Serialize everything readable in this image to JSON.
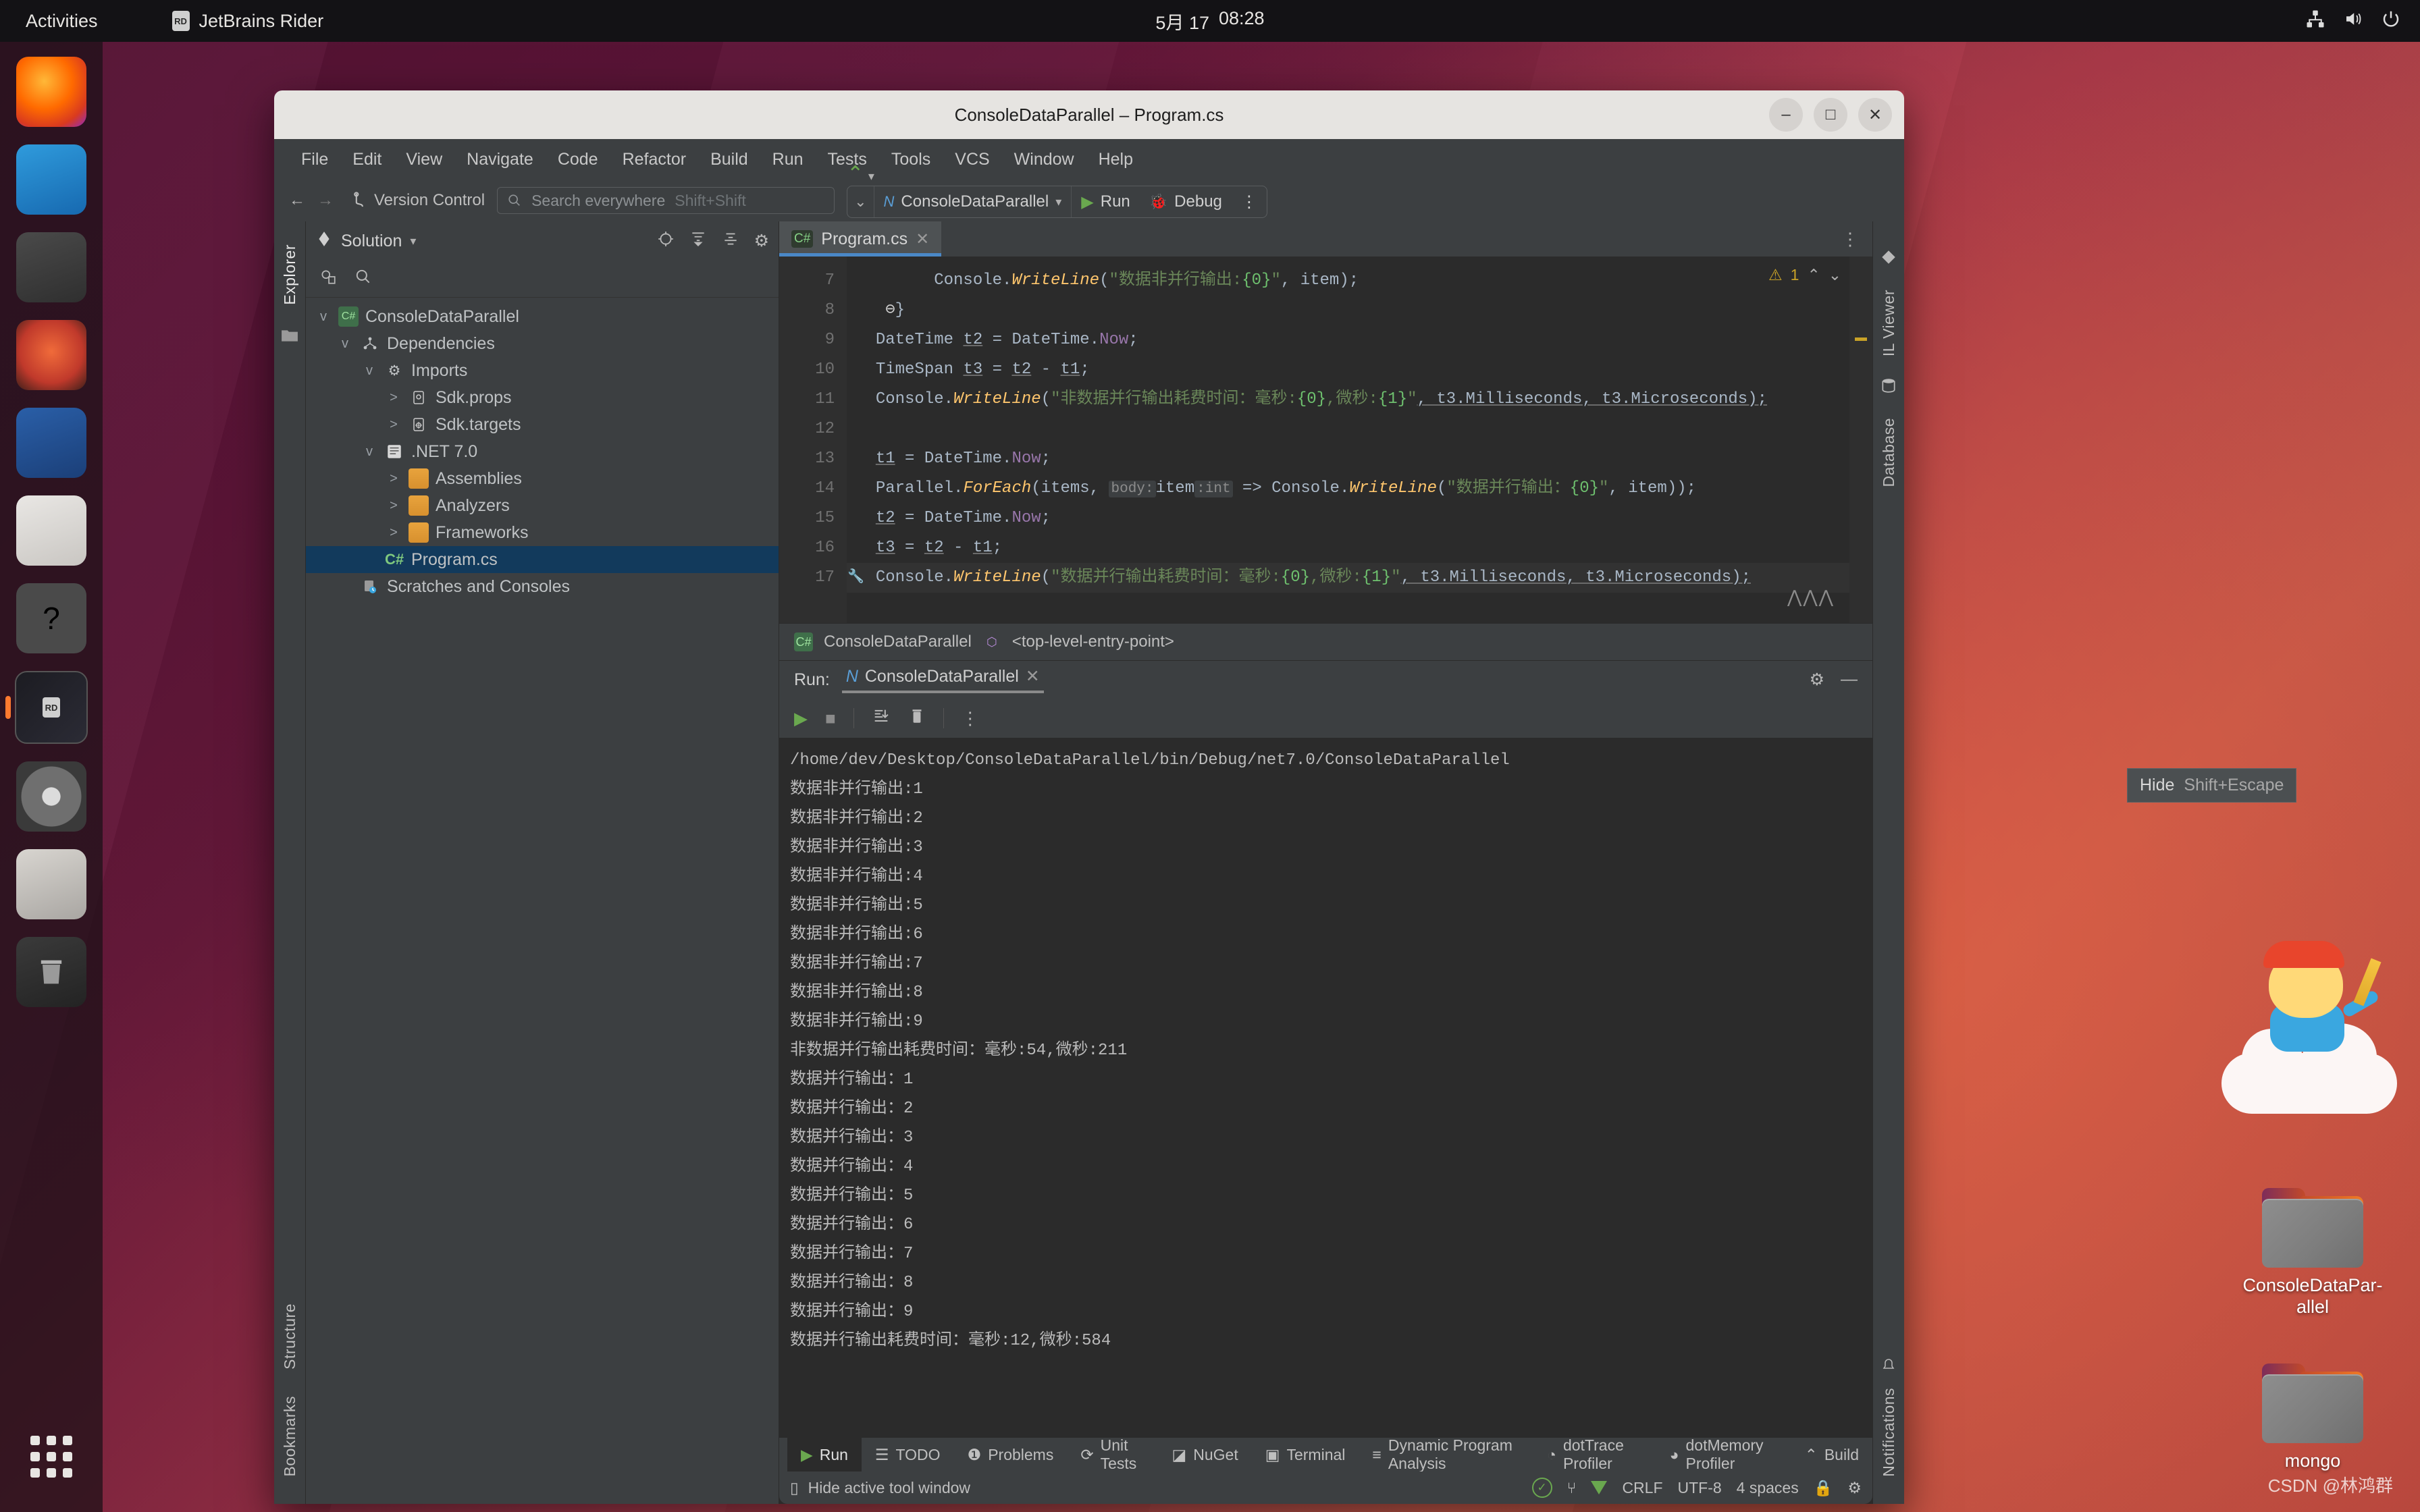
{
  "topbar": {
    "activities": "Activities",
    "app_name": "JetBrains Rider",
    "app_icon": "rider-icon",
    "date": "5月 17",
    "time": "08:28",
    "tray": [
      "network-icon",
      "volume-icon",
      "power-icon"
    ]
  },
  "dock": {
    "items": [
      {
        "name": "firefox",
        "label": "Firefox"
      },
      {
        "name": "thunderbird",
        "label": "Thunderbird"
      },
      {
        "name": "files",
        "label": "Files"
      },
      {
        "name": "rhythmbox",
        "label": "Rhythmbox"
      },
      {
        "name": "libreoffice-writer",
        "label": "LibreOffice Writer"
      },
      {
        "name": "ubuntu-software",
        "label": "Ubuntu Software"
      },
      {
        "name": "help",
        "label": "Help"
      },
      {
        "name": "rider",
        "label": "JetBrains Rider"
      },
      {
        "name": "disc",
        "label": "Disc"
      },
      {
        "name": "text-editor",
        "label": "Text Editor"
      },
      {
        "name": "trash",
        "label": "Trash"
      }
    ],
    "show_apps": "Show Applications"
  },
  "desktop": {
    "icons": [
      {
        "label": "ConsoleDataPar-\nallel"
      },
      {
        "label": "mongo"
      }
    ],
    "watermark": "CSDN @林鸿群"
  },
  "window": {
    "title": "ConsoleDataParallel – Program.cs",
    "controls": {
      "minimize": "–",
      "maximize": "□",
      "close": "✕"
    }
  },
  "menubar": {
    "items": [
      "File",
      "Edit",
      "View",
      "Navigate",
      "Code",
      "Refactor",
      "Build",
      "Run",
      "Tests",
      "Tools",
      "VCS",
      "Window",
      "Help"
    ]
  },
  "navbar": {
    "back": "←",
    "forward": "→",
    "version_control": "Version Control",
    "search_placeholder": "Search everywhere",
    "search_shortcut": "Shift+Shift",
    "run_config": "ConsoleDataParallel",
    "run_label": "Run",
    "debug_label": "Debug",
    "more_label": "⋮",
    "settings_label": "settings-icon"
  },
  "left_strip": {
    "explorer": "Explorer",
    "folder_icon": "folder-icon"
  },
  "solution": {
    "title": "Solution",
    "toolbar_icons": [
      "locate-icon",
      "expand-all-icon",
      "collapse-all-icon",
      "settings-icon"
    ],
    "subbar_icons": [
      "project-view-icon",
      "search-icon"
    ],
    "tree": [
      {
        "label": "ConsoleDataParallel",
        "indent": 0,
        "chevron": "v",
        "icon": "csharp-project-icon",
        "selected": false
      },
      {
        "label": "Dependencies",
        "indent": 1,
        "chevron": "v",
        "icon": "dependencies-icon",
        "selected": false
      },
      {
        "label": "Imports",
        "indent": 2,
        "chevron": "v",
        "icon": "gear-icon",
        "selected": false
      },
      {
        "label": "Sdk.props",
        "indent": 3,
        "chevron": ">",
        "icon": "props-file-icon",
        "selected": false
      },
      {
        "label": "Sdk.targets",
        "indent": 3,
        "chevron": ">",
        "icon": "targets-file-icon",
        "selected": false
      },
      {
        "label": ".NET 7.0",
        "indent": 2,
        "chevron": "v",
        "icon": "framework-icon",
        "selected": false
      },
      {
        "label": "Assemblies",
        "indent": 3,
        "chevron": ">",
        "icon": "folder-icon",
        "selected": false
      },
      {
        "label": "Analyzers",
        "indent": 3,
        "chevron": ">",
        "icon": "folder-icon",
        "selected": false
      },
      {
        "label": "Frameworks",
        "indent": 3,
        "chevron": ">",
        "icon": "folder-icon",
        "selected": false
      },
      {
        "label": "Program.cs",
        "indent": 2,
        "chevron": "",
        "icon": "csharp-file-icon",
        "selected": true
      },
      {
        "label": "Scratches and Consoles",
        "indent": 1,
        "chevron": "",
        "icon": "scratches-icon",
        "selected": false
      }
    ]
  },
  "editor": {
    "tab": {
      "label": "Program.cs",
      "icon": "csharp-file-icon",
      "close": "✕"
    },
    "inspection": {
      "warning_count": "1",
      "warning_icon": "warning-triangle-icon",
      "up": "⌃",
      "down": "⌄"
    },
    "lines": [
      {
        "num": "7",
        "marker": ""
      },
      {
        "num": "8",
        "marker": ""
      },
      {
        "num": "9",
        "marker": ""
      },
      {
        "num": "10",
        "marker": ""
      },
      {
        "num": "11",
        "marker": ""
      },
      {
        "num": "12",
        "marker": ""
      },
      {
        "num": "13",
        "marker": ""
      },
      {
        "num": "14",
        "marker": ""
      },
      {
        "num": "15",
        "marker": ""
      },
      {
        "num": "16",
        "marker": ""
      },
      {
        "num": "17",
        "marker": "wrench-icon"
      }
    ],
    "code": {
      "l7_call": "Console.",
      "l7_fn": "WriteLine",
      "l7_str": "\"数据非并行输出:",
      "l7_fmt": "{0}",
      "l7_str2": "\"",
      "l7_args": ", item);",
      "l8": "}",
      "l9_type": "DateTime",
      "l9_var": "t2",
      "l9_rest": " = DateTime.",
      "l9_now": "Now",
      "l9_semi": ";",
      "l10_type": "TimeSpan",
      "l10_var": "t3",
      "l10_rest": " = ",
      "l10_v2": "t2",
      "l10_minus": " - ",
      "l10_v1": "t1",
      "l10_semi": ";",
      "l11_call": "Console.",
      "l11_fn": "WriteLine",
      "l11_str": "\"非数据并行输出耗费时间：毫秒:",
      "l11_f0": "{0}",
      "l11_str2": ",微秒:",
      "l11_f1": "{1}",
      "l11_str3": "\"",
      "l11_args_a": ", t3.Milliseconds, t3.Microseconds);",
      "l13_var": "t1",
      "l13_rest": " = DateTime.",
      "l13_now": "Now",
      "l13_semi": ";",
      "l14_a": "Parallel.",
      "l14_fn": "ForEach",
      "l14_b": "(items, ",
      "l14_hint": "body:",
      "l14_param": "item",
      "l14_hint2": ":int",
      "l14_c": " => Console.",
      "l14_fn2": "WriteLine",
      "l14_str": "\"数据并行输出：",
      "l14_f0": "{0}",
      "l14_str2": "\"",
      "l14_d": ", item));",
      "l15_var": "t2",
      "l15_rest": " = DateTime.",
      "l15_now": "Now",
      "l15_semi": ";",
      "l16_var": "t3",
      "l16_rest": " = ",
      "l16_v2": "t2",
      "l16_minus": " - ",
      "l16_v1": "t1",
      "l16_semi": ";",
      "l17_call": "Console.",
      "l17_fn": "WriteLine",
      "l17_str": "\"数据并行输出耗费时间：毫秒:",
      "l17_f0": "{0}",
      "l17_str2": ",微秒:",
      "l17_f1": "{1}",
      "l17_str3": "\"",
      "l17_args": ", t3.Milliseconds, t3.Microseconds);"
    },
    "breadcrumb": {
      "project": "ConsoleDataParallel",
      "member": "<top-level-entry-point>",
      "project_icon": "csharp-project-icon",
      "member_icon": "method-icon"
    }
  },
  "run_window": {
    "label": "Run:",
    "tab": "ConsoleDataParallel",
    "tab_icon": "dotnet-icon",
    "tab_close": "✕",
    "header_icons": [
      "settings-icon",
      "minimize-icon"
    ],
    "tool_icons": [
      "rerun-icon",
      "stop-icon",
      "scroll-to-end-icon",
      "trash-icon",
      "more-icon"
    ],
    "output": [
      "/home/dev/Desktop/ConsoleDataParallel/bin/Debug/net7.0/ConsoleDataParallel",
      "数据非并行输出:1",
      "数据非并行输出:2",
      "数据非并行输出:3",
      "数据非并行输出:4",
      "数据非并行输出:5",
      "数据非并行输出:6",
      "数据非并行输出:7",
      "数据非并行输出:8",
      "数据非并行输出:9",
      "非数据并行输出耗费时间：毫秒:54,微秒:211",
      "数据并行输出：1",
      "数据并行输出：2",
      "数据并行输出：3",
      "数据并行输出：4",
      "数据并行输出：5",
      "数据并行输出：6",
      "数据并行输出：7",
      "数据并行输出：8",
      "数据并行输出：9",
      "数据并行输出耗费时间：毫秒:12,微秒:584"
    ]
  },
  "bottom_tools": [
    {
      "label": "Run",
      "icon": "run-icon",
      "selected": true
    },
    {
      "label": "TODO",
      "icon": "todo-icon",
      "selected": false
    },
    {
      "label": "Problems",
      "icon": "problems-icon",
      "selected": false
    },
    {
      "label": "Unit Tests",
      "icon": "unit-tests-icon",
      "selected": false
    },
    {
      "label": "NuGet",
      "icon": "nuget-icon",
      "selected": false
    },
    {
      "label": "Terminal",
      "icon": "terminal-icon",
      "selected": false
    },
    {
      "label": "Dynamic Program Analysis",
      "icon": "dpa-icon",
      "selected": false
    },
    {
      "label": "dotTrace Profiler",
      "icon": "dottrace-icon",
      "selected": false
    },
    {
      "label": "dotMemory Profiler",
      "icon": "dotmemory-icon",
      "selected": false
    },
    {
      "label": "Build",
      "icon": "build-icon",
      "selected": false
    }
  ],
  "statusbar": {
    "hide_tool_window": "Hide active tool window",
    "hide_icon": "tool-window-icon",
    "line_ending": "CRLF",
    "encoding": "UTF-8",
    "indent": "4 spaces",
    "lock_icon": "lock-icon",
    "inspection_icon": "inspection-ok-icon",
    "analysis_icon": "analysis-icon",
    "tri_icon": "green-triangle-icon",
    "settings_icon": "settings-icon"
  },
  "left_vbar": {
    "structure": "Structure",
    "bookmarks": "Bookmarks"
  },
  "right_vbar": {
    "il_viewer": "IL Viewer",
    "database": "Database",
    "notifications": "Notifications"
  },
  "tooltip": {
    "label": "Hide",
    "shortcut": "Shift+Escape"
  }
}
